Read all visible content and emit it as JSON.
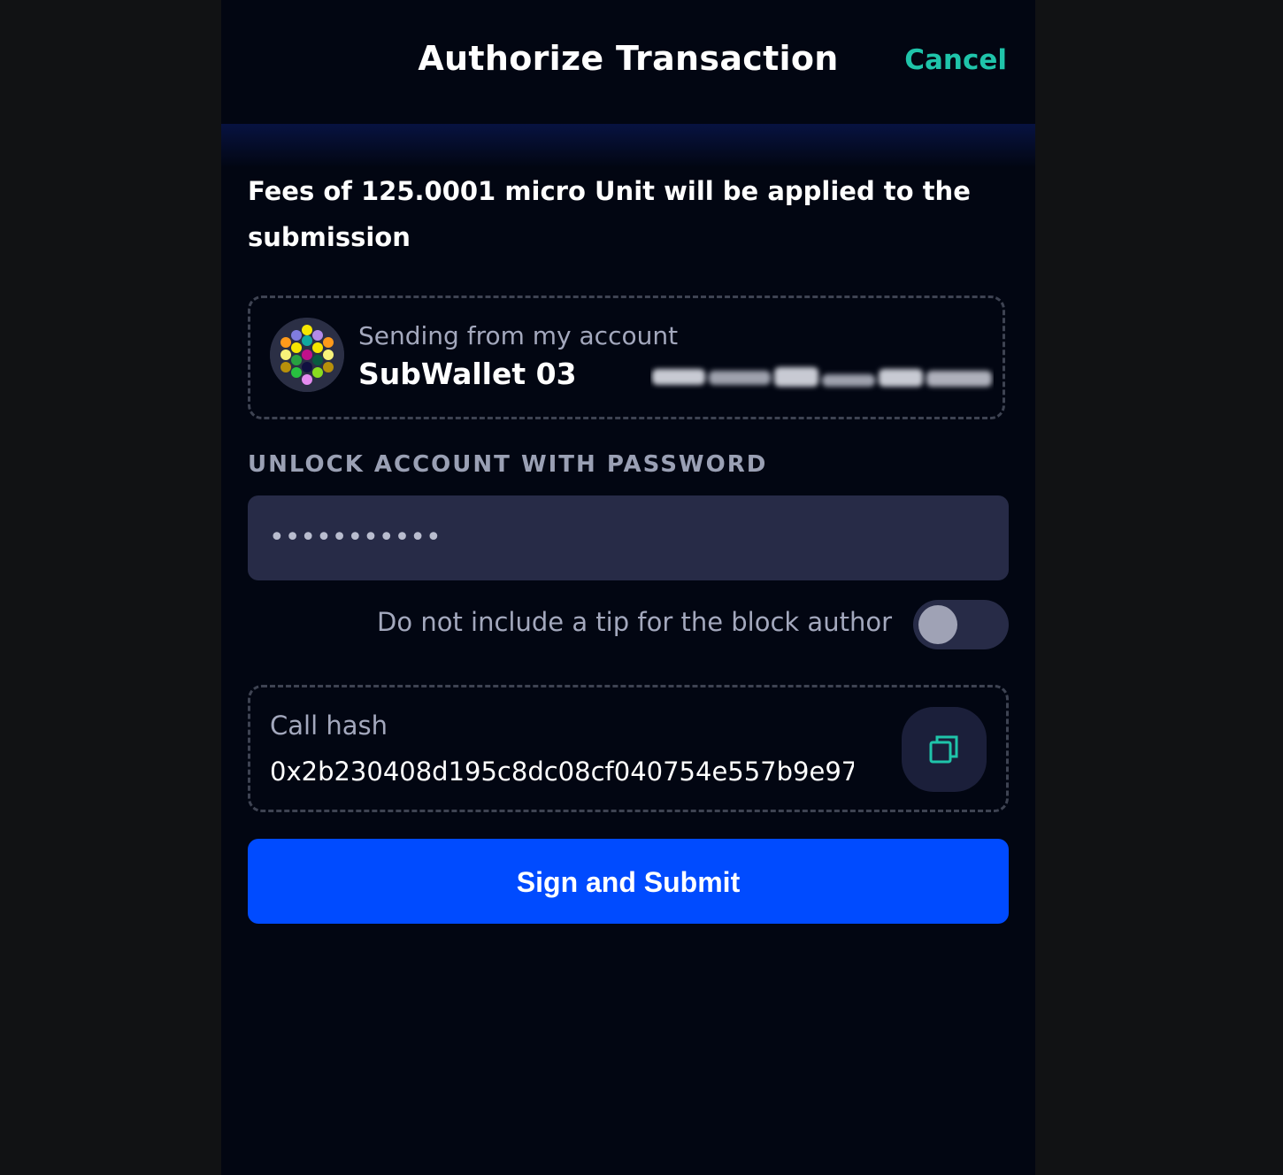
{
  "header": {
    "title": "Authorize Transaction",
    "cancel_label": "Cancel"
  },
  "fees": {
    "text": "Fees of 125.0001 micro Unit will be applied to the submission"
  },
  "account": {
    "label": "Sending from my account",
    "name": "SubWallet 03",
    "address_hidden": true
  },
  "password": {
    "section_label": "UNLOCK ACCOUNT WITH PASSWORD",
    "masked_value": "•••••••••••"
  },
  "tip": {
    "label": "Do not include a tip for the block author",
    "enabled": false
  },
  "call_hash": {
    "label": "Call hash",
    "value": "0x2b230408d195c8dc08cf040754e557b9e97..."
  },
  "submit": {
    "label": "Sign and Submit"
  },
  "colors": {
    "accent": "#1fc4aa",
    "primary_button": "#004bff",
    "panel_bg": "#020612",
    "input_bg": "#272b47"
  },
  "icons": {
    "copy": "copy-icon",
    "avatar": "identicon-avatar"
  }
}
